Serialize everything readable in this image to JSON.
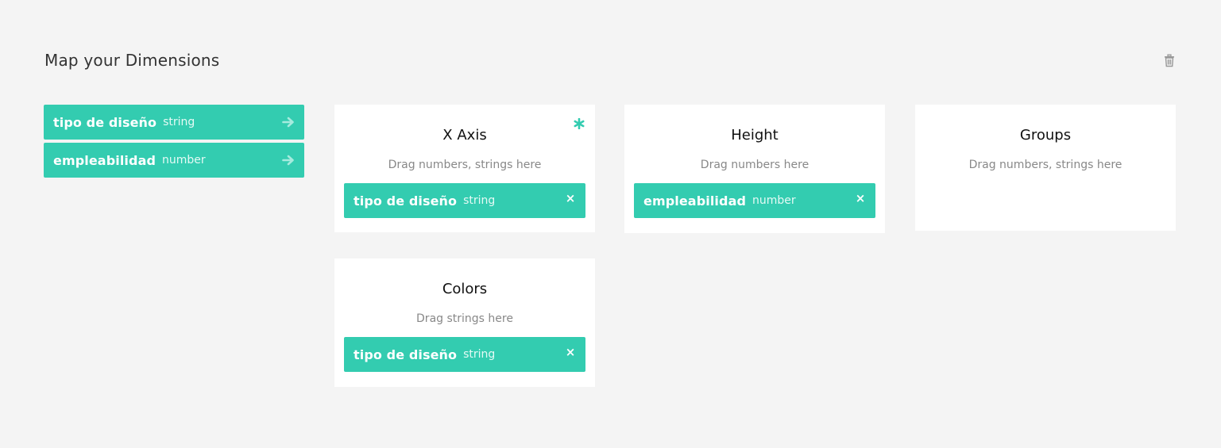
{
  "header": {
    "title": "Map your Dimensions",
    "delete_icon": "trash-icon"
  },
  "colors": {
    "accent": "#33ccb0",
    "background": "#f4f4f4",
    "card": "#ffffff"
  },
  "dimensions": [
    {
      "name": "tipo de diseño",
      "type": "string",
      "icon": "arrow-right-icon"
    },
    {
      "name": "empleabilidad",
      "type": "number",
      "icon": "arrow-right-icon"
    }
  ],
  "slots": {
    "x_axis": {
      "title": "X Axis",
      "hint": "Drag numbers, strings here",
      "required_icon": "asterisk-icon",
      "assigned": {
        "name": "tipo de diseño",
        "type": "string",
        "remove_icon": "close-icon",
        "remove_glyph": "×"
      }
    },
    "height": {
      "title": "Height",
      "hint": "Drag numbers here",
      "assigned": {
        "name": "empleabilidad",
        "type": "number",
        "remove_icon": "close-icon",
        "remove_glyph": "×"
      }
    },
    "groups": {
      "title": "Groups",
      "hint": "Drag numbers, strings here"
    },
    "colors": {
      "title": "Colors",
      "hint": "Drag strings here",
      "assigned": {
        "name": "tipo de diseño",
        "type": "string",
        "remove_icon": "close-icon",
        "remove_glyph": "×"
      }
    }
  }
}
